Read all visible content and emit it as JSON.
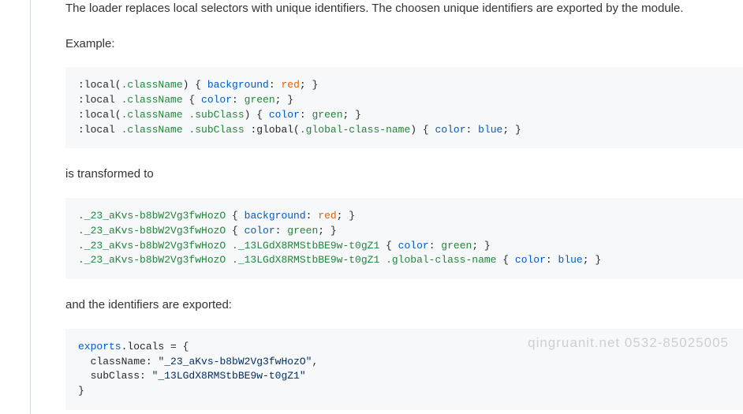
{
  "intro_text": "The loader replaces local selectors with unique identifiers. The choosen unique identifiers are exported by the module.",
  "example_label": "Example:",
  "code_block_1": {
    "lines": [
      [
        {
          "t": ":local(",
          "c": "tk-punc"
        },
        {
          "t": ".className",
          "c": "tk-sel2"
        },
        {
          "t": ") { ",
          "c": "tk-punc"
        },
        {
          "t": "background",
          "c": "tk-prop"
        },
        {
          "t": ": ",
          "c": "tk-punc"
        },
        {
          "t": "red",
          "c": "tk-val-red"
        },
        {
          "t": "; }",
          "c": "tk-punc"
        }
      ],
      [
        {
          "t": ":local ",
          "c": "tk-punc"
        },
        {
          "t": ".className",
          "c": "tk-sel2"
        },
        {
          "t": " { ",
          "c": "tk-punc"
        },
        {
          "t": "color",
          "c": "tk-prop"
        },
        {
          "t": ": ",
          "c": "tk-punc"
        },
        {
          "t": "green",
          "c": "tk-val-green"
        },
        {
          "t": "; }",
          "c": "tk-punc"
        }
      ],
      [
        {
          "t": ":local(",
          "c": "tk-punc"
        },
        {
          "t": ".className .subClass",
          "c": "tk-sel2"
        },
        {
          "t": ") { ",
          "c": "tk-punc"
        },
        {
          "t": "color",
          "c": "tk-prop"
        },
        {
          "t": ": ",
          "c": "tk-punc"
        },
        {
          "t": "green",
          "c": "tk-val-green"
        },
        {
          "t": "; }",
          "c": "tk-punc"
        }
      ],
      [
        {
          "t": ":local ",
          "c": "tk-punc"
        },
        {
          "t": ".className .subClass",
          "c": "tk-sel2"
        },
        {
          "t": " :global(",
          "c": "tk-punc"
        },
        {
          "t": ".global-class-name",
          "c": "tk-sel2"
        },
        {
          "t": ") { ",
          "c": "tk-punc"
        },
        {
          "t": "color",
          "c": "tk-prop"
        },
        {
          "t": ": ",
          "c": "tk-punc"
        },
        {
          "t": "blue",
          "c": "tk-val-blue"
        },
        {
          "t": "; }",
          "c": "tk-punc"
        }
      ]
    ]
  },
  "transformed_label": "is transformed to",
  "code_block_2": {
    "lines": [
      [
        {
          "t": "._23_aKvs-b8bW2Vg3fwHozO",
          "c": "tk-sel2"
        },
        {
          "t": " { ",
          "c": "tk-punc"
        },
        {
          "t": "background",
          "c": "tk-prop"
        },
        {
          "t": ": ",
          "c": "tk-punc"
        },
        {
          "t": "red",
          "c": "tk-val-red"
        },
        {
          "t": "; }",
          "c": "tk-punc"
        }
      ],
      [
        {
          "t": "._23_aKvs-b8bW2Vg3fwHozO",
          "c": "tk-sel2"
        },
        {
          "t": " { ",
          "c": "tk-punc"
        },
        {
          "t": "color",
          "c": "tk-prop"
        },
        {
          "t": ": ",
          "c": "tk-punc"
        },
        {
          "t": "green",
          "c": "tk-val-green"
        },
        {
          "t": "; }",
          "c": "tk-punc"
        }
      ],
      [
        {
          "t": "._23_aKvs-b8bW2Vg3fwHozO ._13LGdX8RMStbBE9w-t0gZ1",
          "c": "tk-sel2"
        },
        {
          "t": " { ",
          "c": "tk-punc"
        },
        {
          "t": "color",
          "c": "tk-prop"
        },
        {
          "t": ": ",
          "c": "tk-punc"
        },
        {
          "t": "green",
          "c": "tk-val-green"
        },
        {
          "t": "; }",
          "c": "tk-punc"
        }
      ],
      [
        {
          "t": "._23_aKvs-b8bW2Vg3fwHozO ._13LGdX8RMStbBE9w-t0gZ1 .global-class-name",
          "c": "tk-sel2"
        },
        {
          "t": " { ",
          "c": "tk-punc"
        },
        {
          "t": "color",
          "c": "tk-prop"
        },
        {
          "t": ": ",
          "c": "tk-punc"
        },
        {
          "t": "blue",
          "c": "tk-val-blue"
        },
        {
          "t": "; }",
          "c": "tk-punc"
        }
      ]
    ]
  },
  "exported_label": "and the identifiers are exported:",
  "code_block_3": {
    "lines": [
      [
        {
          "t": "exports",
          "c": "tk-kw"
        },
        {
          "t": ".locals = {",
          "c": "tk-plain"
        }
      ],
      [
        {
          "t": "  className",
          "c": "tk-plain"
        },
        {
          "t": ": ",
          "c": "tk-punc"
        },
        {
          "t": "\"_23_aKvs-b8bW2Vg3fwHozO\"",
          "c": "tk-str"
        },
        {
          "t": ",",
          "c": "tk-plain"
        }
      ],
      [
        {
          "t": "  subClass",
          "c": "tk-plain"
        },
        {
          "t": ": ",
          "c": "tk-punc"
        },
        {
          "t": "\"_13LGdX8RMStbBE9w-t0gZ1\"",
          "c": "tk-str"
        }
      ],
      [
        {
          "t": "}",
          "c": "tk-plain"
        }
      ]
    ]
  },
  "watermark_text": "qingruanit.net 0532-85025005"
}
